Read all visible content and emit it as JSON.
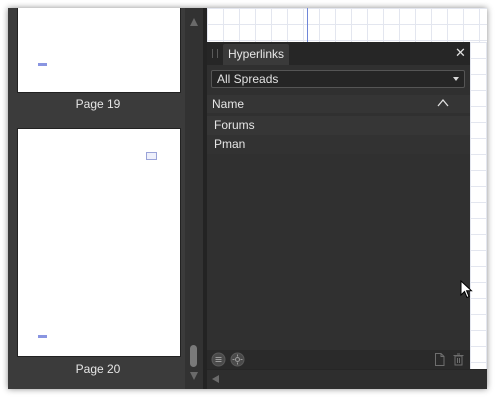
{
  "pages_panel": {
    "pages": [
      {
        "label": "Page 19"
      },
      {
        "label": "Page 20"
      }
    ]
  },
  "hyperlinks_panel": {
    "tab_label": "Hyperlinks",
    "close_icon": "close-icon",
    "scope_dropdown": {
      "selected": "All Spreads"
    },
    "column_header": {
      "name": "Name",
      "sort": "ascending"
    },
    "items": [
      {
        "name": "Forums"
      },
      {
        "name": "Pman"
      }
    ],
    "footer_icons": [
      "list-options-icon",
      "navigate-icon",
      "new-document-icon",
      "trash-icon"
    ]
  },
  "colors": {
    "panel_bg": "#303030",
    "header_bg": "#262626",
    "text": "#e6e6e6",
    "guide": "#6f86d8"
  }
}
